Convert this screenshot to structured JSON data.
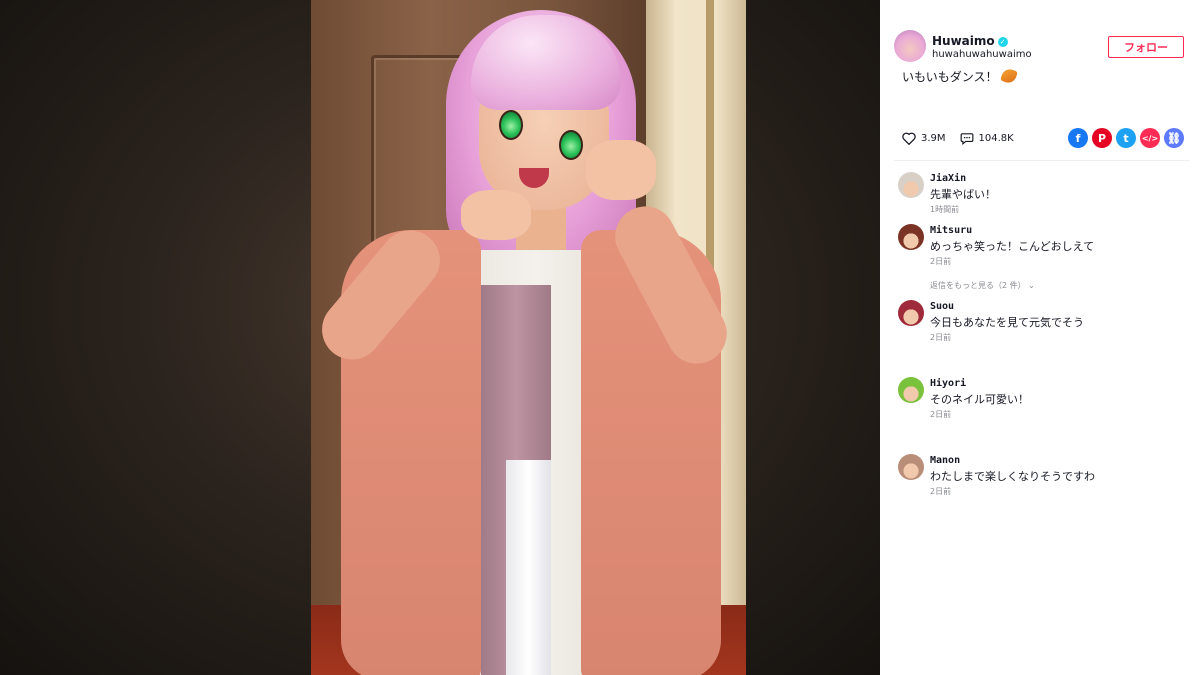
{
  "video": {
    "alt": ""
  },
  "author": {
    "name": "Huwaimo",
    "verified_mark": "✓",
    "handle": "huwahuwahuwaimo",
    "follow_label": "フォロー"
  },
  "caption": {
    "text": "いもいもダンス！",
    "emoji_icon": "sweet-potato-icon"
  },
  "stats": {
    "likes": "3.9M",
    "comments": "104.8K"
  },
  "share": {
    "facebook": "f",
    "pinterest": "P",
    "twitter": "t",
    "embed": "</>",
    "link": "⛓"
  },
  "comments": [
    {
      "user": "JiaXin",
      "text": "先輩やばい！",
      "time": "1時間前",
      "avatar_color": "#d8cfc6"
    },
    {
      "user": "Mitsuru",
      "text": "めっちゃ笑った！こんどおしえて",
      "time": "2日前",
      "avatar_color": "#7a3324",
      "replies": "返信をもっと見る（2 件） ⌄"
    },
    {
      "user": "Suou",
      "text": "今日もあなたを見て元気でそう",
      "time": "2日前",
      "avatar_color": "#9e2a3a"
    },
    {
      "user": "Hiyori",
      "text": "そのネイル可愛い！",
      "time": "2日前",
      "avatar_color": "#7bc23c"
    },
    {
      "user": "Manon",
      "text": "わたしまで楽しくなりそうですわ",
      "time": "2日前",
      "avatar_color": "#b98e78"
    }
  ]
}
